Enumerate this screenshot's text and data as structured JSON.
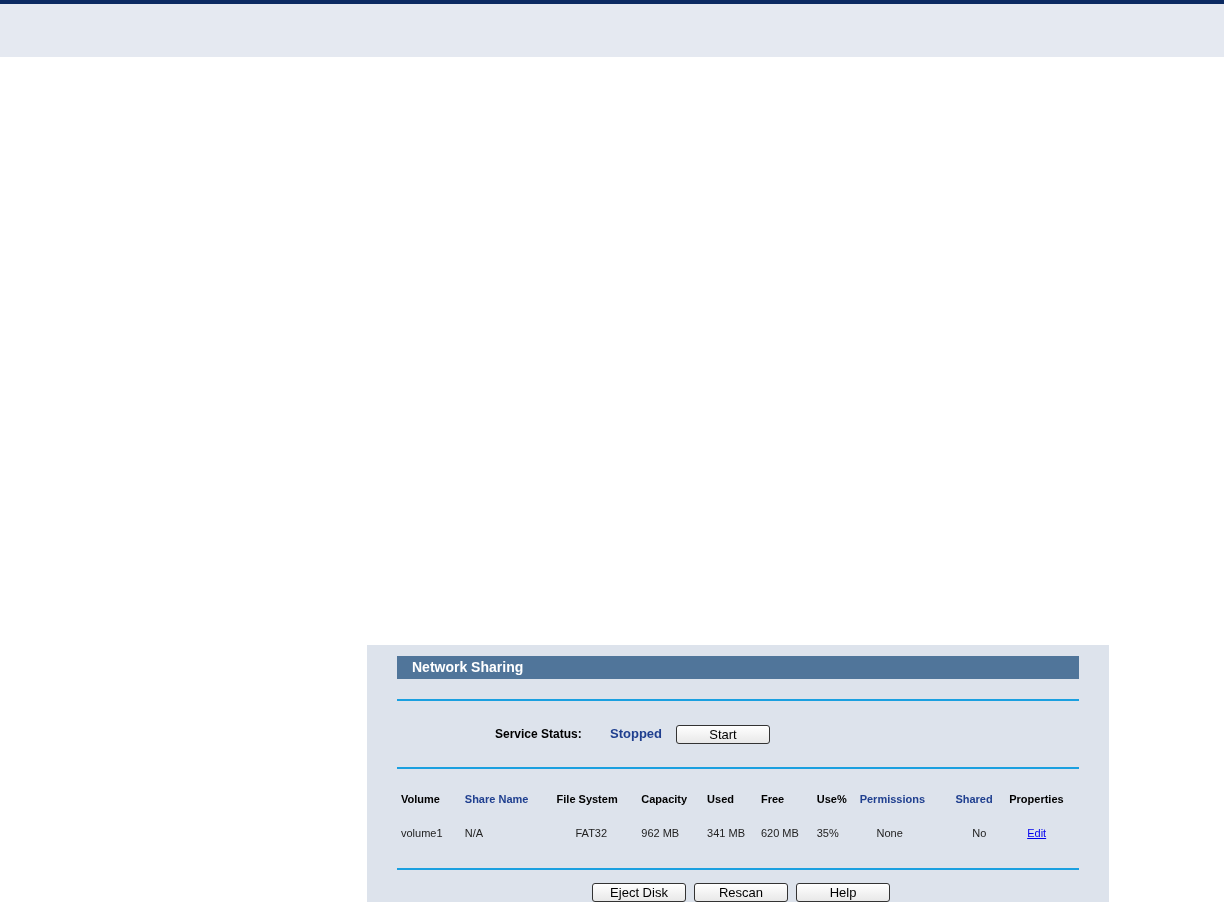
{
  "panel": {
    "title": "Network Sharing",
    "service": {
      "label": "Service Status:",
      "status": "Stopped",
      "button": "Start"
    },
    "table": {
      "columns": [
        {
          "label": "Volume",
          "color": "#000000"
        },
        {
          "label": "Share Name",
          "color": "#1f3f8f"
        },
        {
          "label": "File System",
          "color": "#000000"
        },
        {
          "label": "Capacity",
          "color": "#000000"
        },
        {
          "label": "Used",
          "color": "#000000"
        },
        {
          "label": "Free",
          "color": "#000000"
        },
        {
          "label": "Use%",
          "color": "#000000"
        },
        {
          "label": "Permissions",
          "color": "#1f3f8f"
        },
        {
          "label": "Shared",
          "color": "#1f3f8f"
        },
        {
          "label": "Properties",
          "color": "#000000"
        }
      ],
      "rows": [
        {
          "cells": [
            "volume1",
            "N/A",
            "FAT32",
            "962 MB",
            "341 MB",
            "620 MB",
            "35%",
            "None",
            "No"
          ],
          "link": "Edit"
        }
      ]
    },
    "buttons": [
      "Eject Disk",
      "Rescan",
      "Help"
    ]
  }
}
